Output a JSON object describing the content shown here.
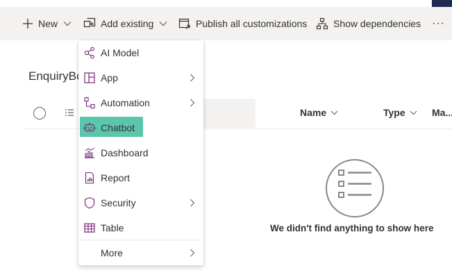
{
  "toolbar": {
    "new_label": "New",
    "add_existing_label": "Add existing",
    "publish_label": "Publish all customizations",
    "dependencies_label": "Show dependencies",
    "overflow_label": "···"
  },
  "page": {
    "title": "EnquiryBot"
  },
  "list": {
    "columns": [
      "Name",
      "Type",
      "Ma..."
    ],
    "empty_message": "We didn't find anything to show here"
  },
  "menu": {
    "items": [
      {
        "label": "AI Model",
        "icon": "ai-model-icon",
        "submenu": false
      },
      {
        "label": "App",
        "icon": "app-icon",
        "submenu": true
      },
      {
        "label": "Automation",
        "icon": "automation-icon",
        "submenu": true
      },
      {
        "label": "Chatbot",
        "icon": "chatbot-icon",
        "submenu": false,
        "highlighted": true
      },
      {
        "label": "Dashboard",
        "icon": "dashboard-icon",
        "submenu": false
      },
      {
        "label": "Report",
        "icon": "report-icon",
        "submenu": false
      },
      {
        "label": "Security",
        "icon": "security-icon",
        "submenu": true
      },
      {
        "label": "Table",
        "icon": "table-icon",
        "submenu": false
      },
      {
        "label": "More",
        "icon": "",
        "submenu": true
      }
    ]
  },
  "colors": {
    "accent": "#742774",
    "highlight": "#5cc6ad",
    "command_bar": "#f3f2f1"
  }
}
